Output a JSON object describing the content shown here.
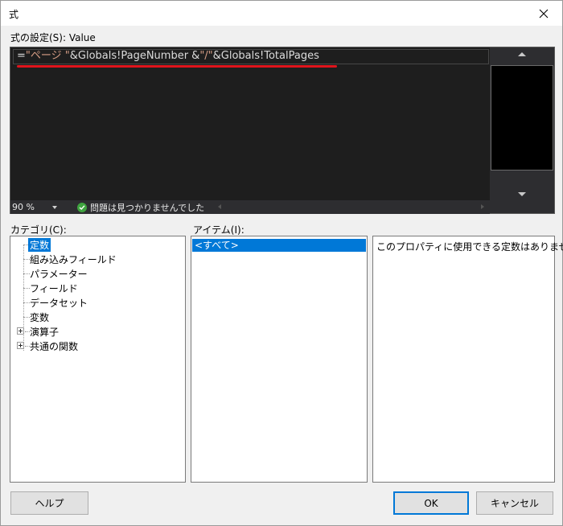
{
  "window": {
    "title": "式"
  },
  "expression": {
    "label": "式の設定(S): Value",
    "code": {
      "p1": "=",
      "p2": "\"ページ \"",
      "p3": "&Globals!PageNumber &",
      "p4": "\"/\"",
      "p5": "&Globals!TotalPages"
    },
    "zoom": "90 %",
    "status": "問題は見つかりませんでした"
  },
  "category": {
    "label": "カテゴリ(C):",
    "items": [
      "定数",
      "組み込みフィールド",
      "パラメーター",
      "フィールド",
      "データセット",
      "変数",
      "演算子",
      "共通の関数"
    ]
  },
  "items_pane": {
    "label": "アイテム(I):",
    "items": [
      "<すべて>"
    ]
  },
  "description": {
    "text": "このプロパティに使用できる定数はありません。"
  },
  "buttons": {
    "help": "ヘルプ",
    "ok": "OK",
    "cancel": "キャンセル"
  },
  "colors": {
    "selection": "#0078d7",
    "editor_bg": "#1e1e1e",
    "underline": "#e0141c",
    "ok_check": "#3fa43f"
  }
}
